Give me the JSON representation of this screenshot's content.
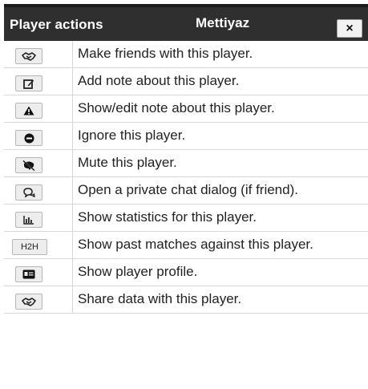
{
  "header": {
    "title": "Player actions",
    "player_name": "Mettiyaz",
    "close_label": "×"
  },
  "actions": [
    {
      "icon": "handshake-icon",
      "label": "Make friends with this player."
    },
    {
      "icon": "edit-note-icon",
      "label": "Add note about this player."
    },
    {
      "icon": "warning-icon",
      "label": "Show/edit note about this player."
    },
    {
      "icon": "ignore-icon",
      "label": "Ignore this player."
    },
    {
      "icon": "mute-icon",
      "label": "Mute this player."
    },
    {
      "icon": "chat-icon",
      "label": "Open a private chat dialog (if friend)."
    },
    {
      "icon": "statistics-icon",
      "label": "Show statistics for this player."
    },
    {
      "icon": "h2h-icon",
      "icon_text": "H2H",
      "label": "Show past matches against this player."
    },
    {
      "icon": "profile-card-icon",
      "label": "Show player profile."
    },
    {
      "icon": "handshake-icon",
      "label": "Share data with this player."
    }
  ]
}
